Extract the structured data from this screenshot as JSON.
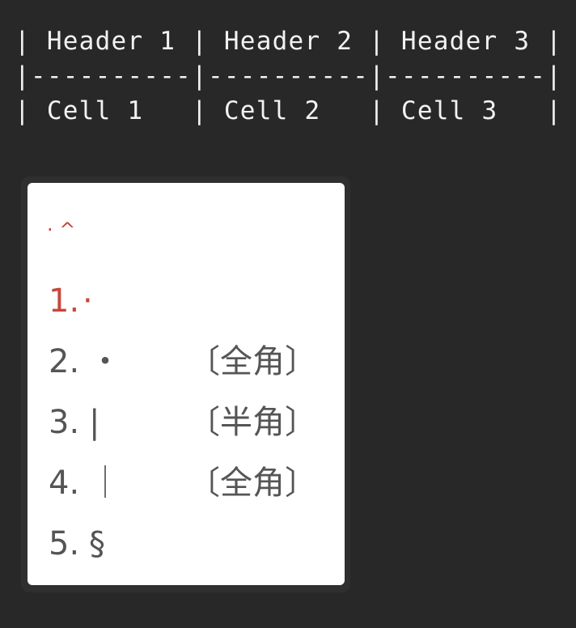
{
  "editor": {
    "table_lines": [
      "| Header 1 | Header 2 | Header 3 |",
      "|----------|----------|----------|",
      "| Cell 1   | Cell 2   | Cell 3   |"
    ],
    "colors": {
      "background": "#282828",
      "text": "#f2f2f2"
    }
  },
  "popup": {
    "header": "· ^",
    "accent_color": "#c5473b",
    "options": [
      {
        "number": "1.",
        "symbol": "·",
        "note": ""
      },
      {
        "number": "2.",
        "symbol": "・",
        "note": "〔全角〕"
      },
      {
        "number": "3.",
        "symbol": "|",
        "note": "〔半角〕"
      },
      {
        "number": "4.",
        "symbol": "｜",
        "note": "〔全角〕"
      },
      {
        "number": "5.",
        "symbol": "§",
        "note": ""
      }
    ]
  }
}
